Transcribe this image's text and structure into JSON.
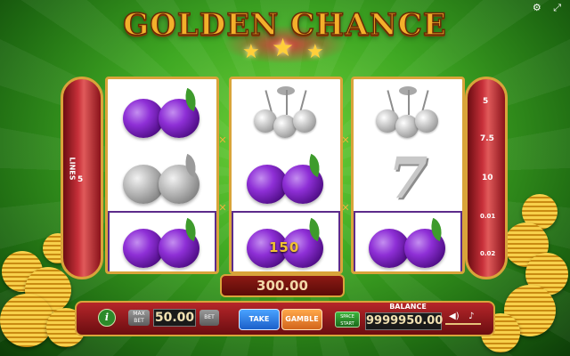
{
  "title": "GOLDEN CHANCE",
  "top_icons": {
    "settings": "gear-icon",
    "fullscreen": "fullscreen-icon"
  },
  "lines_label": "LINES",
  "left_line_number": "5",
  "right_multipliers": [
    "5",
    "7.5",
    "10",
    "0.01",
    "0.02"
  ],
  "reels": [
    [
      "plum-purple",
      "plum-grey",
      "plum-purple"
    ],
    [
      "cherry-grey",
      "plum-purple",
      "plum-purple"
    ],
    [
      "cherry-grey",
      "seven-grey",
      "plum-purple"
    ]
  ],
  "winning_row": 3,
  "line_win": "150",
  "total_win": "300.00",
  "panel": {
    "info_label": "i",
    "max_bet_label": "MAX BET",
    "bet_label": "BET",
    "bet_value": "50.00",
    "take_label": "TAKE",
    "gamble_label": "GAMBLE",
    "start_label": "SPACE START",
    "balance_label": "BALANCE",
    "balance_value": "9999950.00",
    "sound_icon": "speaker-icon",
    "music_icon": "music-note-icon"
  },
  "colors": {
    "accent_gold": "#d9a43a",
    "panel_red": "#b6262a",
    "plum_purple": "#8e2fd6",
    "background_green": "#3fa823"
  }
}
